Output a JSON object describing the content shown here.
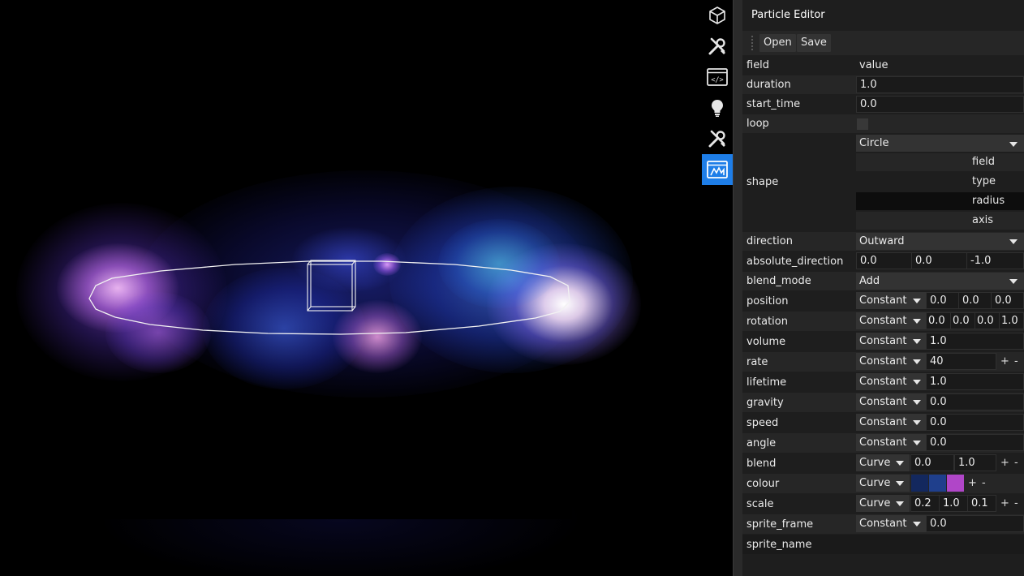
{
  "colors": {
    "accent": "#1e7ee8",
    "panel_bg": "#1e1e1e",
    "row_alt": "#262626",
    "swatch_1": "#13285e",
    "swatch_2": "#1f3f8c",
    "swatch_3": "#b046c8"
  },
  "toolbar": {
    "items": [
      {
        "icon": "cube-icon"
      },
      {
        "icon": "wrench-screwdriver-icon"
      },
      {
        "icon": "code-window-icon"
      },
      {
        "icon": "lightbulb-icon"
      },
      {
        "icon": "wrench-screwdriver-icon"
      },
      {
        "icon": "particle-window-icon",
        "active": true
      }
    ]
  },
  "panel": {
    "title": "Particle Editor",
    "menu": {
      "open": "Open",
      "save": "Save"
    },
    "header": {
      "field": "field",
      "value": "value"
    },
    "duration": {
      "label": "duration",
      "value": "1.0"
    },
    "start_time": {
      "label": "start_time",
      "value": "0.0"
    },
    "loop": {
      "label": "loop",
      "checked": false
    },
    "shape": {
      "label": "shape",
      "value": "Circle",
      "sub_fields": [
        "field",
        "type",
        "radius",
        "axis"
      ]
    },
    "direction": {
      "label": "direction",
      "value": "Outward"
    },
    "absolute_direction": {
      "label": "absolute_direction",
      "values": [
        "0.0",
        "0.0",
        "-1.0"
      ]
    },
    "blend_mode": {
      "label": "blend_mode",
      "value": "Add"
    },
    "position": {
      "label": "position",
      "mode": "Constant",
      "values": [
        "0.0",
        "0.0",
        "0.0"
      ]
    },
    "rotation": {
      "label": "rotation",
      "mode": "Constant",
      "values": [
        "0.0",
        "0.0",
        "0.0",
        "1.0"
      ]
    },
    "volume": {
      "label": "volume",
      "mode": "Constant",
      "value": "1.0"
    },
    "rate": {
      "label": "rate",
      "mode": "Constant",
      "value": "40"
    },
    "lifetime": {
      "label": "lifetime",
      "mode": "Constant",
      "value": "1.0"
    },
    "gravity": {
      "label": "gravity",
      "mode": "Constant",
      "value": "0.0"
    },
    "speed": {
      "label": "speed",
      "mode": "Constant",
      "value": "0.0"
    },
    "angle": {
      "label": "angle",
      "mode": "Constant",
      "value": "0.0"
    },
    "blend": {
      "label": "blend",
      "mode": "Curve",
      "values": [
        "0.0",
        "1.0"
      ]
    },
    "colour": {
      "label": "colour",
      "mode": "Curve"
    },
    "scale": {
      "label": "scale",
      "mode": "Curve",
      "values": [
        "0.2",
        "1.0",
        "0.1"
      ]
    },
    "sprite_frame": {
      "label": "sprite_frame",
      "mode": "Constant",
      "value": "0.0"
    },
    "sprite_name": {
      "label": "sprite_name"
    },
    "plus": "+",
    "minus": "-"
  }
}
